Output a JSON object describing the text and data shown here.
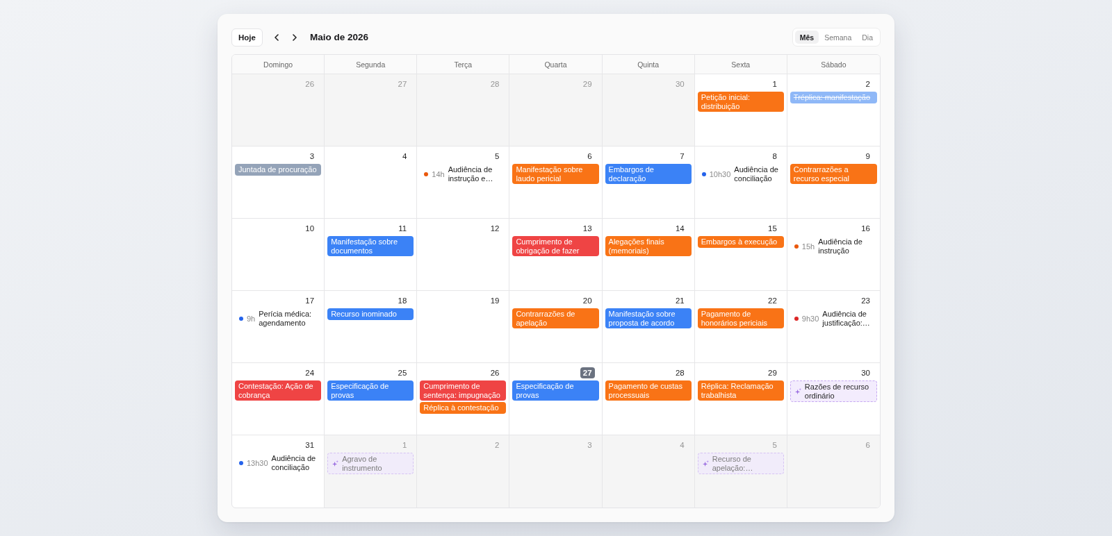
{
  "toolbar": {
    "today_button": "Hoje",
    "title": "Maio de 2026",
    "views": [
      {
        "label": "Mês",
        "selected": true
      },
      {
        "label": "Semana",
        "selected": false
      },
      {
        "label": "Dia",
        "selected": false
      }
    ]
  },
  "weekdays": [
    "Domingo",
    "Segunda",
    "Terça",
    "Quarta",
    "Quinta",
    "Sexta",
    "Sábado"
  ],
  "weeks": [
    {
      "days": [
        {
          "day": "26",
          "outside": true,
          "today": false
        },
        {
          "day": "27",
          "outside": true,
          "today": false
        },
        {
          "day": "28",
          "outside": true,
          "today": false
        },
        {
          "day": "29",
          "outside": true,
          "today": false
        },
        {
          "day": "30",
          "outside": true,
          "today": false
        },
        {
          "day": "1",
          "outside": false,
          "today": false,
          "events": [
            {
              "kind": "block",
              "title": "Petição inicial: distribuição",
              "color": "#f97316",
              "done": false
            }
          ]
        },
        {
          "day": "2",
          "outside": false,
          "today": false,
          "events": [
            {
              "kind": "block",
              "title": "Tréplica: manifestação",
              "color": "#8fb8f7",
              "done": true
            }
          ]
        }
      ]
    },
    {
      "days": [
        {
          "day": "3",
          "outside": false,
          "today": false,
          "events": [
            {
              "kind": "block",
              "title": "Juntada de procuração",
              "color": "#94a3b8",
              "done": false
            }
          ]
        },
        {
          "day": "4",
          "outside": false,
          "today": false
        },
        {
          "day": "5",
          "outside": false,
          "today": false,
          "events": [
            {
              "kind": "timed",
              "time": "14h",
              "title": "Audiência de instrução e…",
              "color": "#ea580c"
            }
          ]
        },
        {
          "day": "6",
          "outside": false,
          "today": false,
          "events": [
            {
              "kind": "block",
              "title": "Manifestação sobre laudo pericial",
              "color": "#f97316",
              "done": false
            }
          ]
        },
        {
          "day": "7",
          "outside": false,
          "today": false,
          "events": [
            {
              "kind": "block",
              "title": "Embargos de declaração",
              "color": "#3b82f6",
              "done": false
            }
          ]
        },
        {
          "day": "8",
          "outside": false,
          "today": false,
          "events": [
            {
              "kind": "timed",
              "time": "10h30",
              "title": "Audiência de conciliação",
              "color": "#2563eb"
            }
          ]
        },
        {
          "day": "9",
          "outside": false,
          "today": false,
          "events": [
            {
              "kind": "block",
              "title": "Contrarrazões a recurso especial",
              "color": "#f97316",
              "done": false
            }
          ]
        }
      ]
    },
    {
      "days": [
        {
          "day": "10",
          "outside": false,
          "today": false
        },
        {
          "day": "11",
          "outside": false,
          "today": false,
          "events": [
            {
              "kind": "block",
              "title": "Manifestação sobre documentos",
              "color": "#3b82f6",
              "done": false
            }
          ]
        },
        {
          "day": "12",
          "outside": false,
          "today": false
        },
        {
          "day": "13",
          "outside": false,
          "today": false,
          "events": [
            {
              "kind": "block",
              "title": "Cumprimento de obrigação de fazer",
              "color": "#ef4444",
              "done": false
            }
          ]
        },
        {
          "day": "14",
          "outside": false,
          "today": false,
          "events": [
            {
              "kind": "block",
              "title": "Alegações finais (memoriais)",
              "color": "#f97316",
              "done": false
            }
          ]
        },
        {
          "day": "15",
          "outside": false,
          "today": false,
          "events": [
            {
              "kind": "block",
              "title": "Embargos à execução",
              "color": "#f97316",
              "done": false
            }
          ]
        },
        {
          "day": "16",
          "outside": false,
          "today": false,
          "events": [
            {
              "kind": "timed",
              "time": "15h",
              "title": "Audiência de instrução",
              "color": "#ea580c"
            }
          ]
        }
      ]
    },
    {
      "days": [
        {
          "day": "17",
          "outside": false,
          "today": false,
          "events": [
            {
              "kind": "timed",
              "time": "9h",
              "title": "Perícia médica: agendamento",
              "color": "#2563eb"
            }
          ]
        },
        {
          "day": "18",
          "outside": false,
          "today": false,
          "events": [
            {
              "kind": "block",
              "title": "Recurso inominado",
              "color": "#3b82f6",
              "done": false
            }
          ]
        },
        {
          "day": "19",
          "outside": false,
          "today": false
        },
        {
          "day": "20",
          "outside": false,
          "today": false,
          "events": [
            {
              "kind": "block",
              "title": "Contrarrazões de apelação",
              "color": "#f97316",
              "done": false
            }
          ]
        },
        {
          "day": "21",
          "outside": false,
          "today": false,
          "events": [
            {
              "kind": "block",
              "title": "Manifestação sobre proposta de acordo",
              "color": "#3b82f6",
              "done": false
            }
          ]
        },
        {
          "day": "22",
          "outside": false,
          "today": false,
          "events": [
            {
              "kind": "block",
              "title": "Pagamento de honorários periciais",
              "color": "#f97316",
              "done": false
            }
          ]
        },
        {
          "day": "23",
          "outside": false,
          "today": false,
          "events": [
            {
              "kind": "timed",
              "time": "9h30",
              "title": "Audiência de justificação:…",
              "color": "#dc2626"
            }
          ]
        }
      ]
    },
    {
      "days": [
        {
          "day": "24",
          "outside": false,
          "today": false,
          "events": [
            {
              "kind": "block",
              "title": "Contestação: Ação de cobrança",
              "color": "#ef4444",
              "done": false
            }
          ]
        },
        {
          "day": "25",
          "outside": false,
          "today": false,
          "events": [
            {
              "kind": "block",
              "title": "Especificação de provas",
              "color": "#3b82f6",
              "done": false
            }
          ]
        },
        {
          "day": "26",
          "outside": false,
          "today": false,
          "events": [
            {
              "kind": "block",
              "title": "Cumprimento de sentença: impugnação",
              "color": "#ef4444",
              "done": false
            },
            {
              "kind": "block",
              "title": "Réplica à contestação",
              "color": "#f97316",
              "done": false
            }
          ]
        },
        {
          "day": "27",
          "outside": false,
          "today": true,
          "events": [
            {
              "kind": "block",
              "title": "Especificação de provas",
              "color": "#3b82f6",
              "done": false
            }
          ]
        },
        {
          "day": "28",
          "outside": false,
          "today": false,
          "events": [
            {
              "kind": "block",
              "title": "Pagamento de custas processuais",
              "color": "#f97316",
              "done": false
            }
          ]
        },
        {
          "day": "29",
          "outside": false,
          "today": false,
          "events": [
            {
              "kind": "block",
              "title": "Réplica: Reclamação trabalhista",
              "color": "#f97316",
              "done": false
            }
          ]
        },
        {
          "day": "30",
          "outside": false,
          "today": false,
          "events": [
            {
              "kind": "draft",
              "title": "Razões de recurso ordinário"
            }
          ]
        }
      ]
    },
    {
      "days": [
        {
          "day": "31",
          "outside": false,
          "today": false,
          "events": [
            {
              "kind": "timed",
              "time": "13h30",
              "title": "Audiência de conciliação",
              "color": "#2563eb"
            }
          ]
        },
        {
          "day": "1",
          "outside": true,
          "today": false,
          "events": [
            {
              "kind": "draft",
              "title": "Agravo de instrumento"
            }
          ]
        },
        {
          "day": "2",
          "outside": true,
          "today": false
        },
        {
          "day": "3",
          "outside": true,
          "today": false
        },
        {
          "day": "4",
          "outside": true,
          "today": false
        },
        {
          "day": "5",
          "outside": true,
          "today": false,
          "events": [
            {
              "kind": "draft",
              "title": "Recurso de apelação:…"
            }
          ]
        },
        {
          "day": "6",
          "outside": true,
          "today": false
        }
      ]
    }
  ]
}
